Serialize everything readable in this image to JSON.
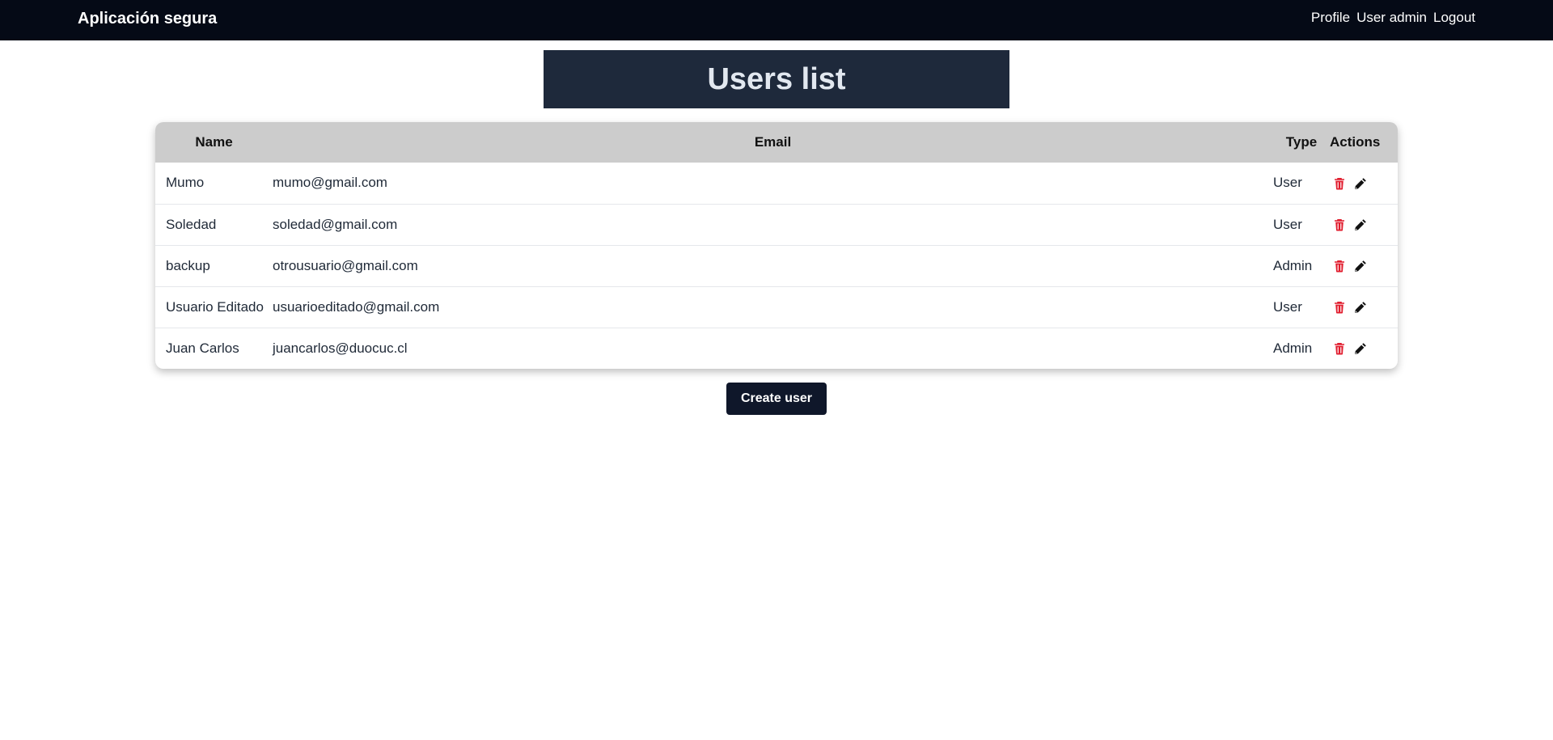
{
  "navbar": {
    "brand": "Aplicación segura",
    "links": [
      "Profile",
      "User admin",
      "Logout"
    ]
  },
  "page": {
    "title": "Users list"
  },
  "table": {
    "headers": {
      "name": "Name",
      "email": "Email",
      "type": "Type",
      "actions": "Actions"
    },
    "rows": [
      {
        "name": "Mumo",
        "email": "mumo@gmail.com",
        "type": "User"
      },
      {
        "name": "Soledad",
        "email": "soledad@gmail.com",
        "type": "User"
      },
      {
        "name": "backup",
        "email": "otrousuario@gmail.com",
        "type": "Admin"
      },
      {
        "name": "Usuario Editado",
        "email": "usuarioeditado@gmail.com",
        "type": "User"
      },
      {
        "name": "Juan Carlos",
        "email": "juancarlos@duocuc.cl",
        "type": "Admin"
      }
    ],
    "row_actions": [
      "trash-icon",
      "pencil-icon"
    ]
  },
  "buttons": {
    "create_user": "Create user"
  },
  "colors": {
    "navbar_bg": "#050a16",
    "title_bg": "#1e293b",
    "header_bg": "#cccccc",
    "delete_icon": "#e11d2e",
    "edit_icon": "#111111",
    "button_bg": "#0f172a"
  }
}
